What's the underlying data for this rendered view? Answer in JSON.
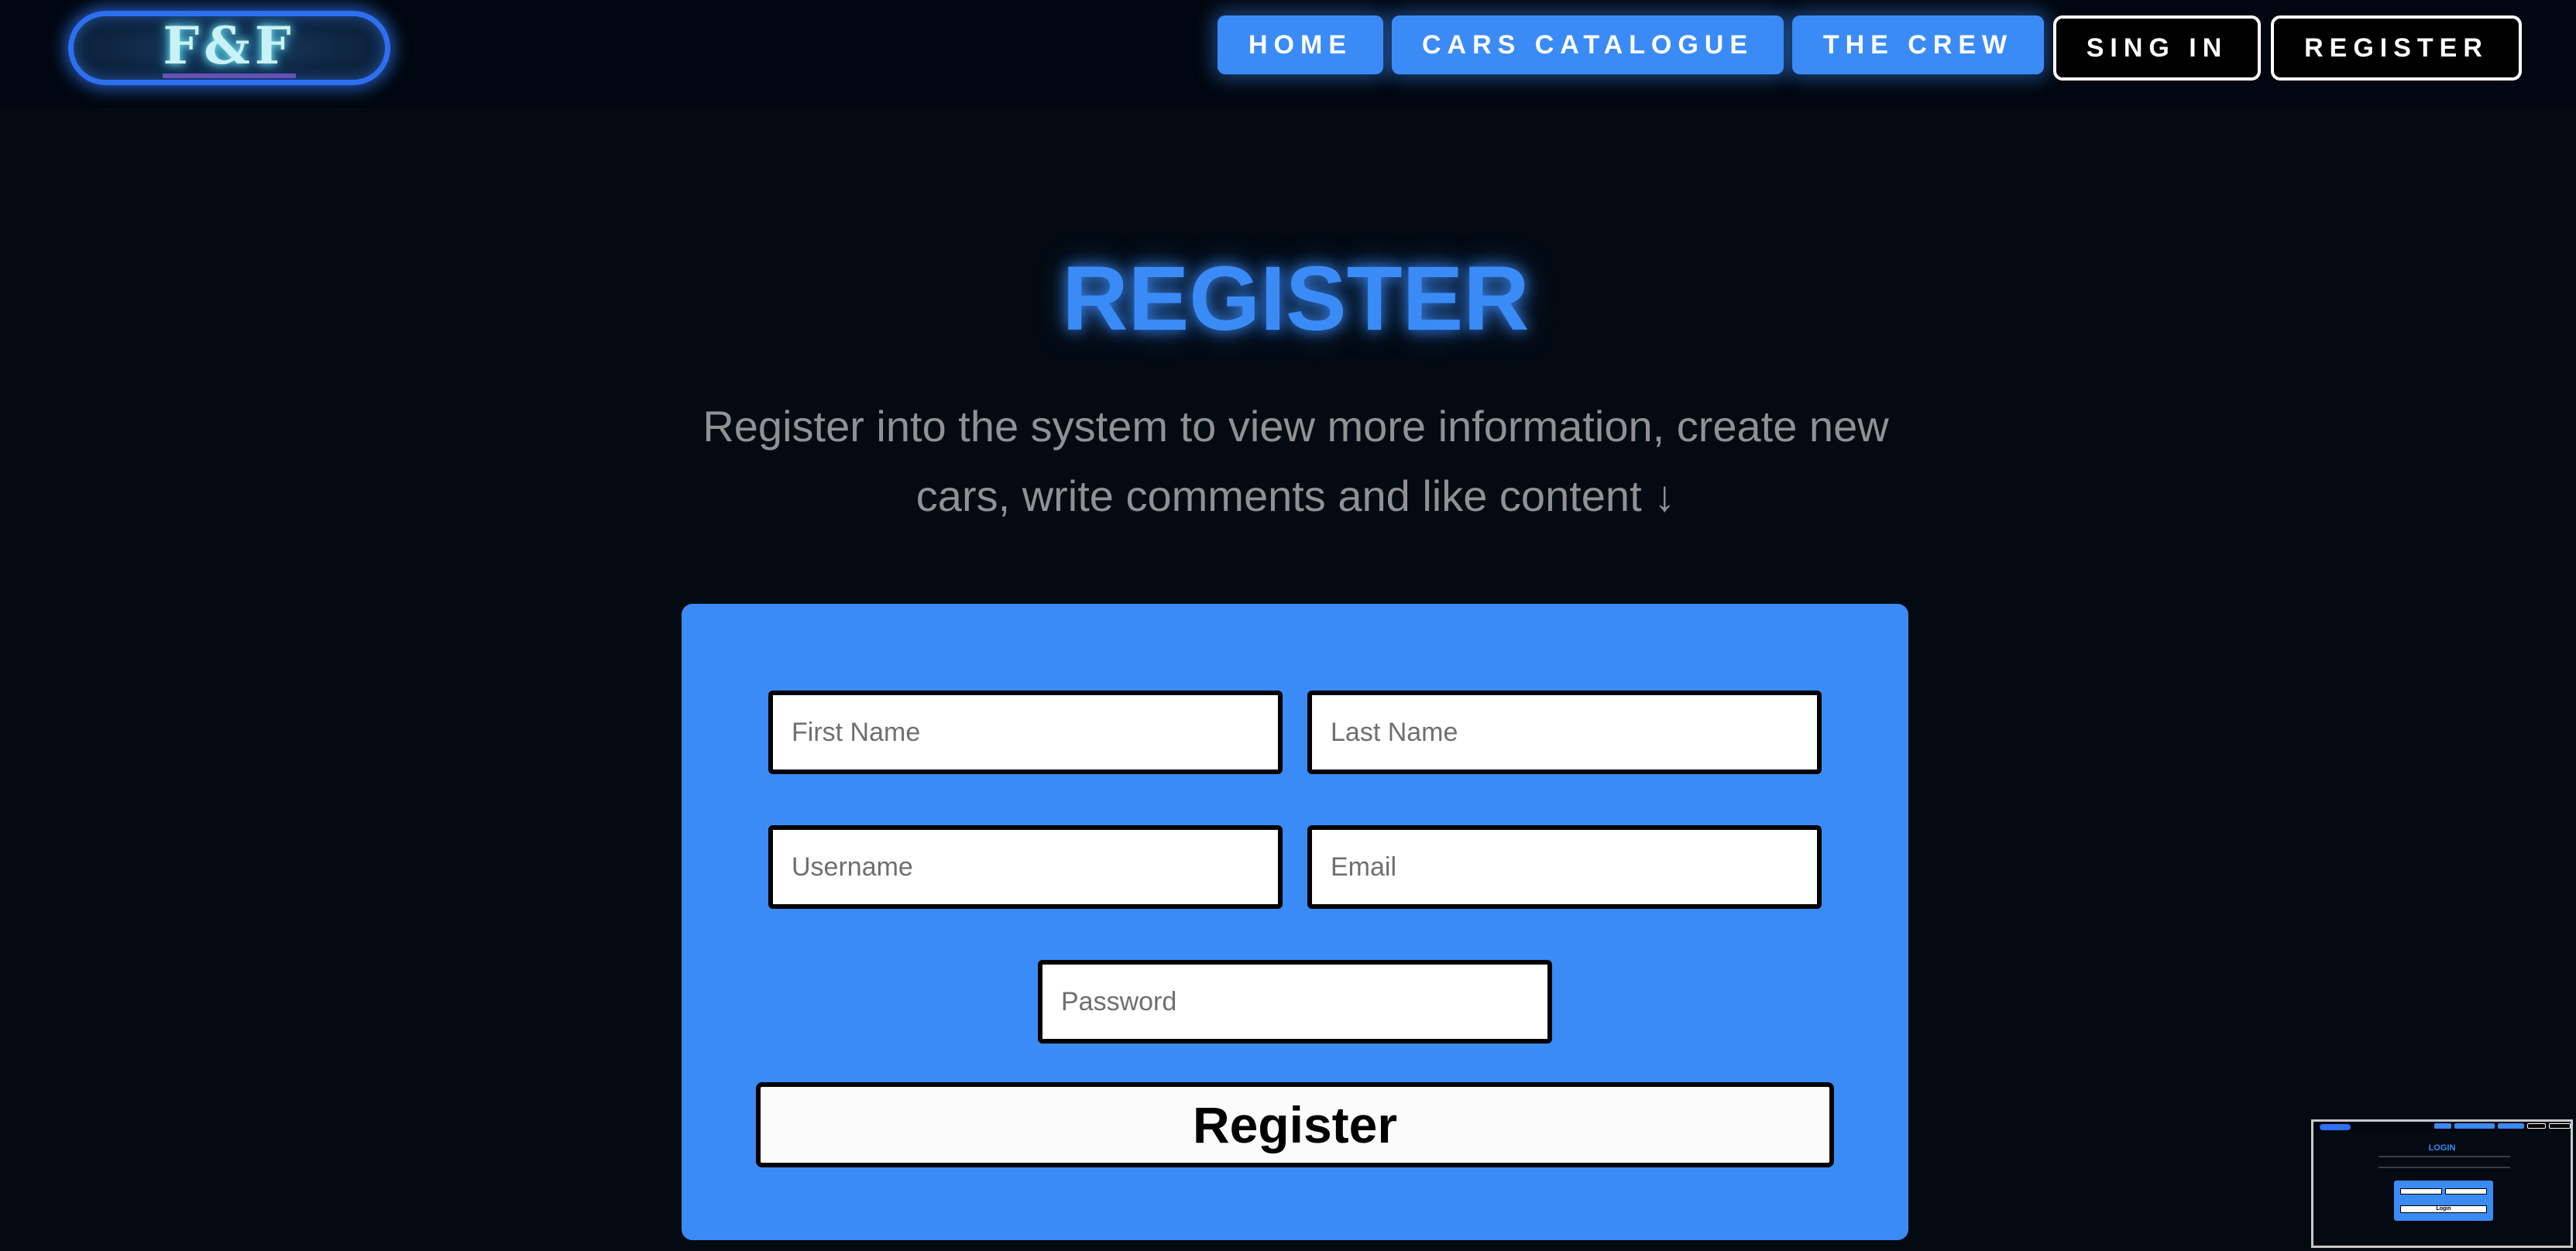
{
  "logo": {
    "text": "F&F"
  },
  "nav": {
    "home": "HOME",
    "cars": "CARS CATALOGUE",
    "crew": "THE CREW",
    "signin": "SING IN",
    "register": "REGISTER"
  },
  "page": {
    "title": "REGISTER",
    "subtitle": "Register into the system to view more information, create new cars, write comments and like content ↓"
  },
  "form": {
    "first_name_placeholder": "First Name",
    "last_name_placeholder": "Last Name",
    "username_placeholder": "Username",
    "email_placeholder": "Email",
    "password_placeholder": "Password",
    "submit_label": "Register"
  },
  "thumbnail": {
    "title": "LOGIN",
    "button": "Login"
  },
  "colors": {
    "accent": "#3b8bf7",
    "background": "#030a12",
    "nav_bar": "#010710"
  }
}
